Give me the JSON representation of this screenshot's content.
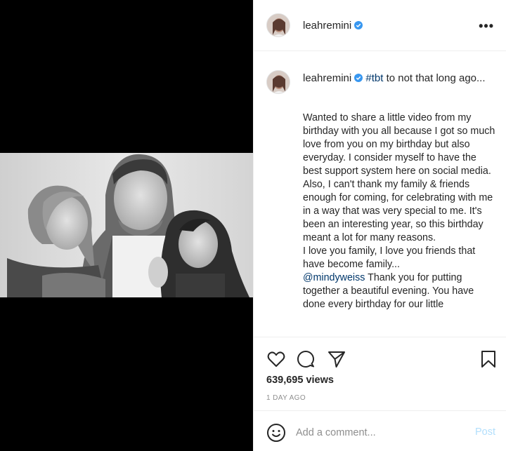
{
  "header": {
    "username": "leahremini",
    "more_label": "•••"
  },
  "caption": {
    "username": "leahremini",
    "hashtag": "#tbt",
    "intro": " to not that long ago...",
    "lines": [
      "Wanted to share a little video from my birthday with you all because I got so much love from you on my birthday but also everyday. I consider myself to have the best support system here on social media. Also, I can't thank my family & friends enough for coming, for celebrating with me in a way that was very special to me. It's been an interesting year, so this birthday meant a lot for many reasons.",
      "I love you family, I love you friends that have become family...",
      "Thank you for putting together a beautiful evening. You have done every birthday for our little"
    ],
    "mention": "@mindyweiss"
  },
  "stats": {
    "views": "639,695 views",
    "time": "1 DAY AGO"
  },
  "comment": {
    "placeholder": "Add a comment...",
    "post_label": "Post"
  },
  "colors": {
    "link": "#00376b",
    "verified": "#3897f0",
    "post_disabled": "#b2dffc",
    "muted": "#8e8e8e"
  }
}
